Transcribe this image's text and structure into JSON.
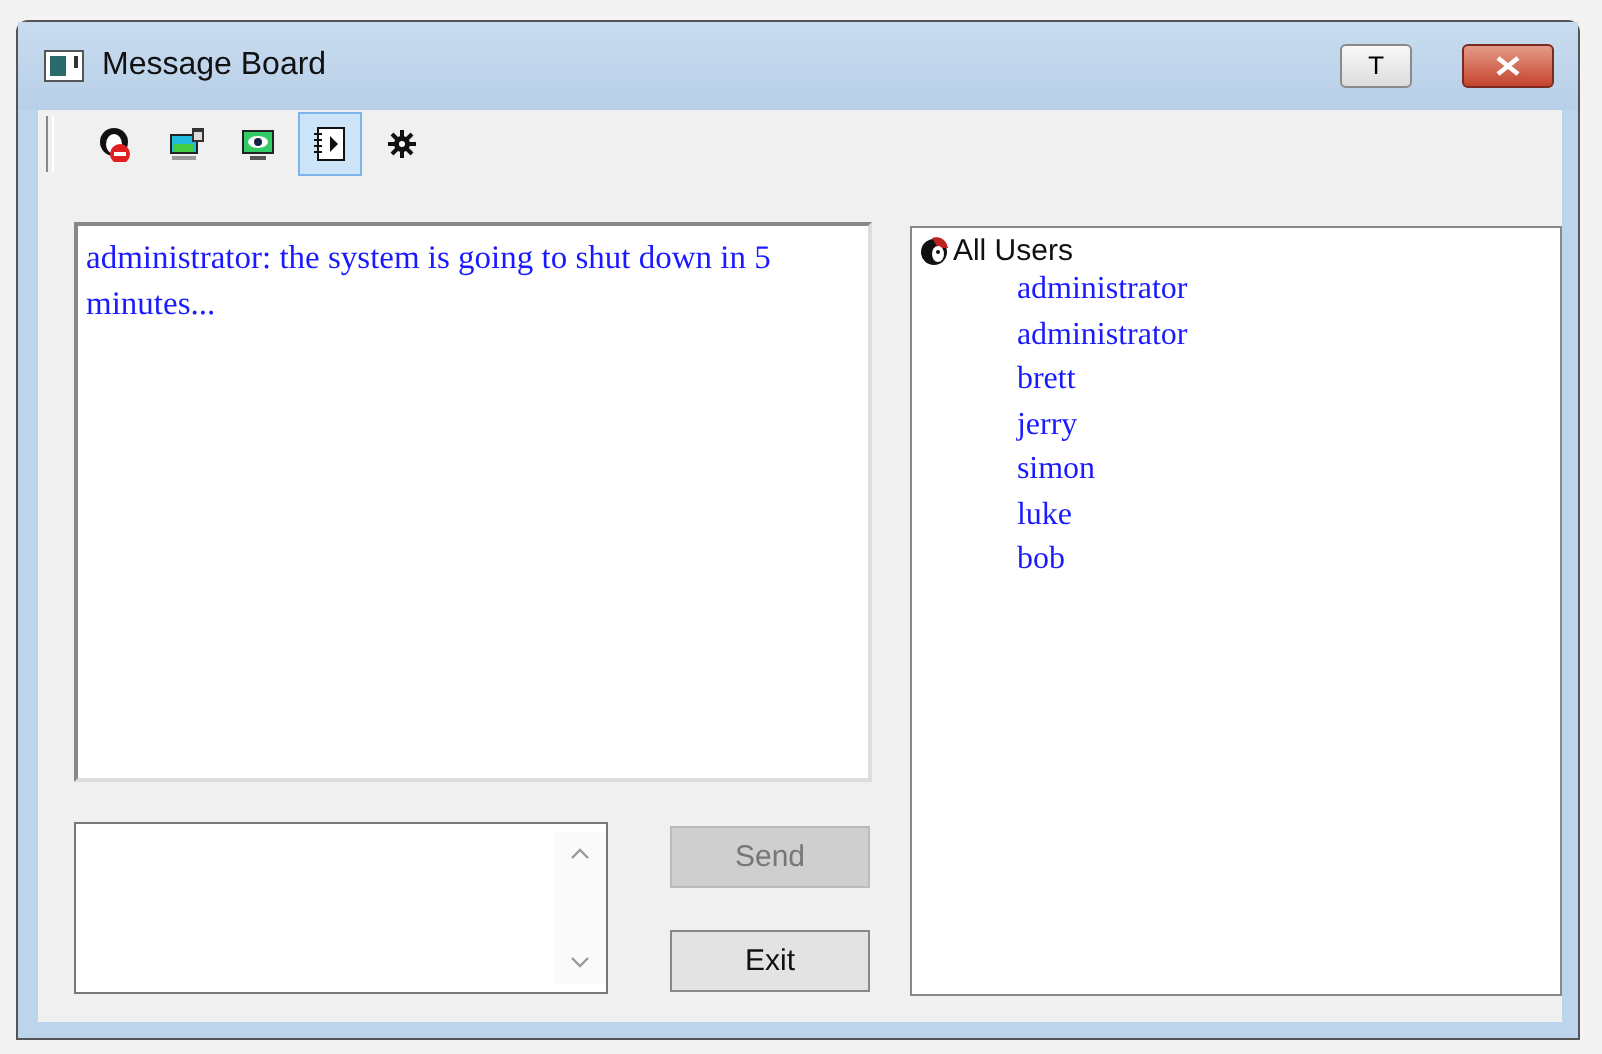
{
  "window": {
    "title": "Message Board",
    "pin_button": "T"
  },
  "toolbar": [
    {
      "selected": false
    },
    {
      "selected": false
    },
    {
      "selected": false
    },
    {
      "selected": true
    },
    {
      "selected": false
    }
  ],
  "messages": [
    "administrator: the system is going to shut down in 5 minutes..."
  ],
  "users": {
    "label": "All Users",
    "children": [
      {
        "label": "administrator"
      },
      {
        "label": "administrator"
      },
      {
        "label": "brett"
      },
      {
        "label": "jerry"
      },
      {
        "label": "simon"
      },
      {
        "label": "luke"
      },
      {
        "label": "bob"
      }
    ]
  },
  "buttons": [
    {
      "label": "Send",
      "disabled": true
    },
    {
      "label": "Exit",
      "disabled": false
    }
  ]
}
